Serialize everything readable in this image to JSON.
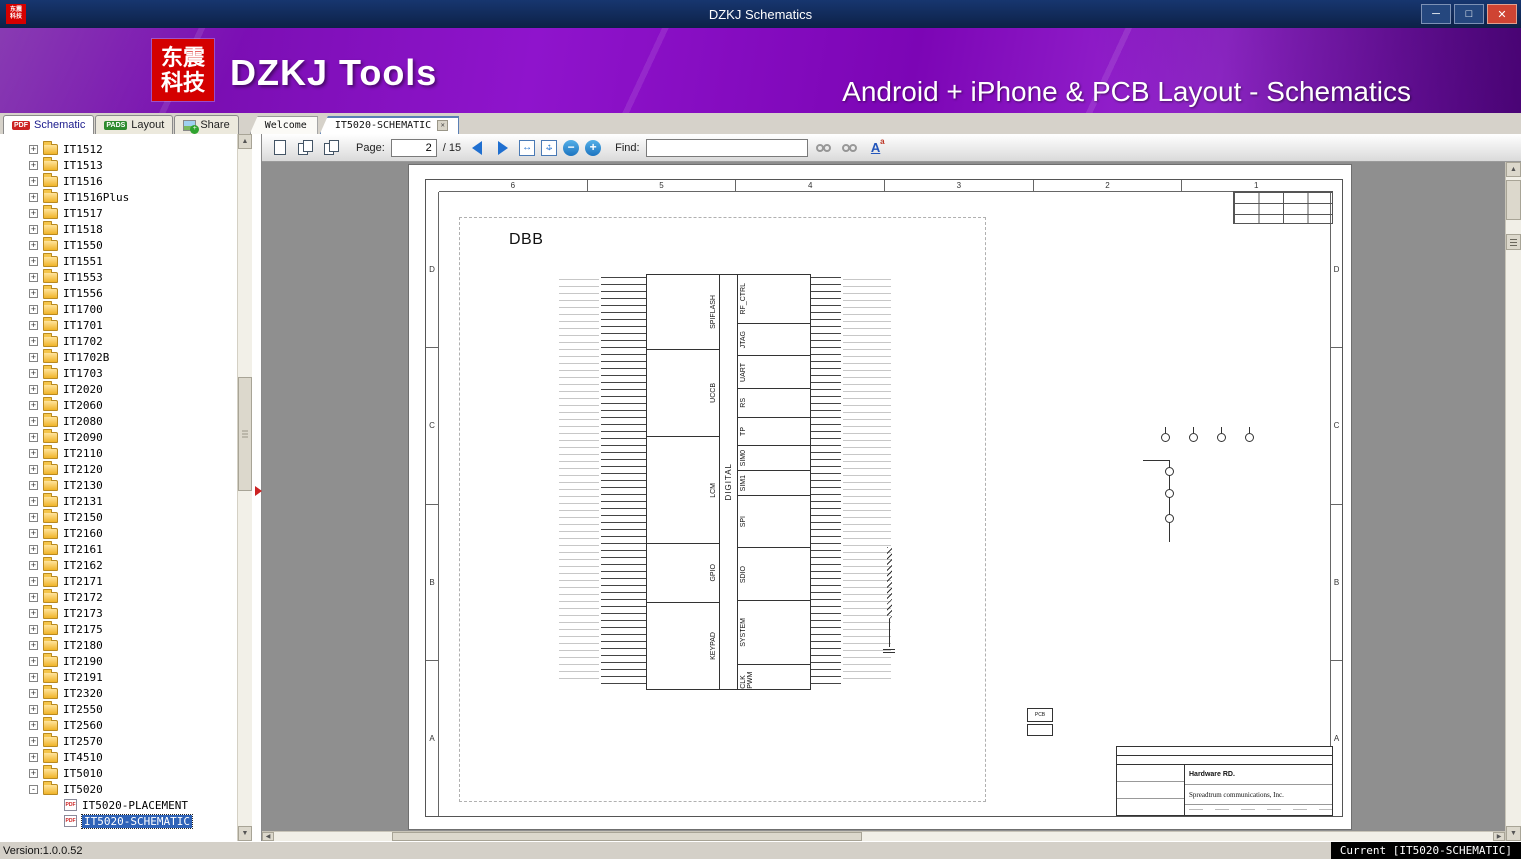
{
  "window": {
    "title": "DZKJ Schematics",
    "minimize": "─",
    "maximize": "□",
    "close": "✕"
  },
  "banner": {
    "logo_top": "东震",
    "logo_bottom": "科技",
    "app_name": "DZKJ Tools",
    "tagline": "Android + iPhone & PCB Layout - Schematics",
    "accent_purple": "#8a10c2",
    "logo_red": "#d40000"
  },
  "mode_tabs": [
    {
      "label": "Schematic",
      "chip": "PDF",
      "active": true
    },
    {
      "label": "Layout",
      "chip": "PADS",
      "active": false
    },
    {
      "label": "Share",
      "chip": "",
      "active": false
    }
  ],
  "doc_tabs": [
    {
      "label": "Welcome",
      "active": false
    },
    {
      "label": "IT5020-SCHEMATIC",
      "active": true,
      "closable": true
    }
  ],
  "toolbar": {
    "page_label": "Page:",
    "page_value": "2",
    "page_total": "/ 15",
    "find_label": "Find:",
    "find_value": ""
  },
  "sidebar": {
    "items": [
      {
        "label": "IT1512",
        "toggle": "+"
      },
      {
        "label": "IT1513",
        "toggle": "+"
      },
      {
        "label": "IT1516",
        "toggle": "+"
      },
      {
        "label": "IT1516Plus",
        "toggle": "+"
      },
      {
        "label": "IT1517",
        "toggle": "+"
      },
      {
        "label": "IT1518",
        "toggle": "+"
      },
      {
        "label": "IT1550",
        "toggle": "+"
      },
      {
        "label": "IT1551",
        "toggle": "+"
      },
      {
        "label": "IT1553",
        "toggle": "+"
      },
      {
        "label": "IT1556",
        "toggle": "+"
      },
      {
        "label": "IT1700",
        "toggle": "+"
      },
      {
        "label": "IT1701",
        "toggle": "+"
      },
      {
        "label": "IT1702",
        "toggle": "+"
      },
      {
        "label": "IT1702B",
        "toggle": "+"
      },
      {
        "label": "IT1703",
        "toggle": "+"
      },
      {
        "label": "IT2020",
        "toggle": "+"
      },
      {
        "label": "IT2060",
        "toggle": "+"
      },
      {
        "label": "IT2080",
        "toggle": "+"
      },
      {
        "label": "IT2090",
        "toggle": "+"
      },
      {
        "label": "IT2110",
        "toggle": "+"
      },
      {
        "label": "IT2120",
        "toggle": "+"
      },
      {
        "label": "IT2130",
        "toggle": "+"
      },
      {
        "label": "IT2131",
        "toggle": "+"
      },
      {
        "label": "IT2150",
        "toggle": "+"
      },
      {
        "label": "IT2160",
        "toggle": "+"
      },
      {
        "label": "IT2161",
        "toggle": "+"
      },
      {
        "label": "IT2162",
        "toggle": "+"
      },
      {
        "label": "IT2171",
        "toggle": "+"
      },
      {
        "label": "IT2172",
        "toggle": "+"
      },
      {
        "label": "IT2173",
        "toggle": "+"
      },
      {
        "label": "IT2175",
        "toggle": "+"
      },
      {
        "label": "IT2180",
        "toggle": "+"
      },
      {
        "label": "IT2190",
        "toggle": "+"
      },
      {
        "label": "IT2191",
        "toggle": "+"
      },
      {
        "label": "IT2320",
        "toggle": "+"
      },
      {
        "label": "IT2550",
        "toggle": "+"
      },
      {
        "label": "IT2560",
        "toggle": "+"
      },
      {
        "label": "IT2570",
        "toggle": "+"
      },
      {
        "label": "IT4510",
        "toggle": "+"
      },
      {
        "label": "IT5010",
        "toggle": "+"
      },
      {
        "label": "IT5020",
        "toggle": "-"
      },
      {
        "label": "IT5020-PLACEMENT",
        "leaf": true
      },
      {
        "label": "IT5020-SCHEMATIC",
        "leaf": true,
        "selected": true
      }
    ]
  },
  "schematic": {
    "sheet_title": "DBB",
    "grid_columns": [
      "6",
      "5",
      "4",
      "3",
      "2",
      "1"
    ],
    "grid_rows": [
      "D",
      "C",
      "B",
      "A"
    ],
    "core_label": "DIGITAL",
    "left_sections": [
      {
        "label": "SPIFLASH",
        "size": 18
      },
      {
        "label": "UCCB",
        "size": 21
      },
      {
        "label": "LCM",
        "size": 26
      },
      {
        "label": "GPIO",
        "size": 14
      },
      {
        "label": "KEYPAD",
        "size": 21
      }
    ],
    "right_sections": [
      {
        "label": "RF_CTRL",
        "size": 12
      },
      {
        "label": "JTAG",
        "size": 8
      },
      {
        "label": "UART",
        "size": 8
      },
      {
        "label": "RS",
        "size": 7
      },
      {
        "label": "TP",
        "size": 7
      },
      {
        "label": "SIM0",
        "size": 6
      },
      {
        "label": "SIM1",
        "size": 6
      },
      {
        "label": "SPI",
        "size": 13
      },
      {
        "label": "SDIO",
        "size": 13
      },
      {
        "label": "SYSTEM",
        "size": 16
      },
      {
        "label": "CLK PWM",
        "size": 6
      }
    ],
    "pcb_label": "PCB",
    "title_block": {
      "dept": "Hardware RD.",
      "company": "Spreadtrum communications, Inc."
    }
  },
  "statusbar": {
    "version": "Version:1.0.0.52",
    "current": "Current [IT5020-SCHEMATIC]"
  }
}
